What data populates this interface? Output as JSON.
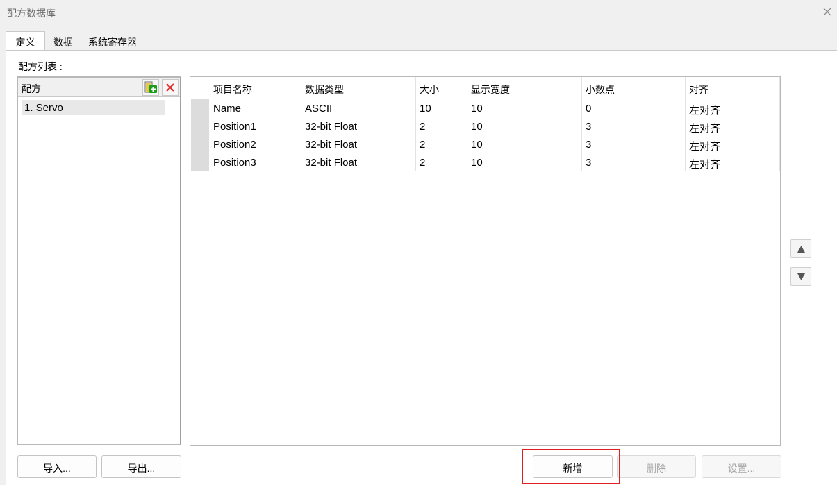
{
  "window": {
    "title": "配方数据库",
    "close_icon": "close-icon"
  },
  "tabs": [
    {
      "label": "定义",
      "active": true
    },
    {
      "label": "数据",
      "active": false
    },
    {
      "label": "系统寄存器",
      "active": false
    }
  ],
  "recipe_list": {
    "label": "配方列表 :",
    "header": "配方",
    "add_icon": "add-recipe-icon",
    "delete_icon": "delete-recipe-icon",
    "items": [
      "1. Servo"
    ]
  },
  "grid": {
    "columns": [
      "项目名称",
      "数据类型",
      "大小",
      "显示宽度",
      "小数点",
      "对齐"
    ],
    "rows": [
      [
        "Name",
        "ASCII",
        "10",
        "10",
        "0",
        "左对齐"
      ],
      [
        "Position1",
        "32-bit Float",
        "2",
        "10",
        "3",
        "左对齐"
      ],
      [
        "Position2",
        "32-bit Float",
        "2",
        "10",
        "3",
        "左对齐"
      ],
      [
        "Position3",
        "32-bit Float",
        "2",
        "10",
        "3",
        "左对齐"
      ]
    ]
  },
  "side_buttons": {
    "up_icon": "arrow-up-icon",
    "down_icon": "arrow-down-icon"
  },
  "buttons": {
    "import": "导入...",
    "export": "导出...",
    "add": "新增",
    "delete": "删除",
    "settings": "设置..."
  },
  "colors": {
    "highlight": "#e02020",
    "add_icon_green": "#1a9e1a",
    "delete_icon_red": "#e03030"
  }
}
